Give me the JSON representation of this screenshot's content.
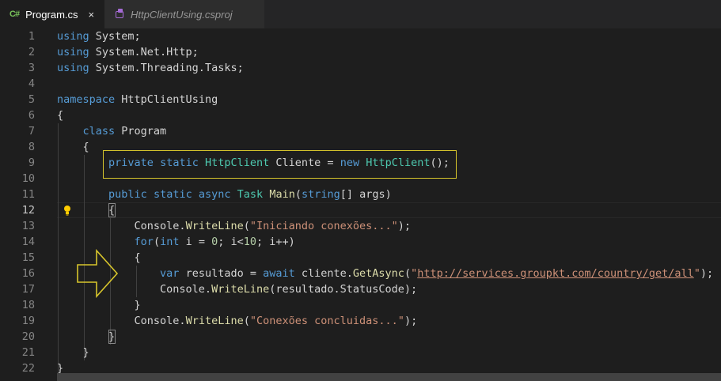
{
  "tabs": [
    {
      "icon": "C#",
      "label": "Program.cs",
      "close": "×"
    },
    {
      "label": "HttpClientUsing.csproj"
    }
  ],
  "lines": [
    {
      "n": "1",
      "t": [
        [
          "kw",
          "using"
        ],
        [
          "punc",
          " System;"
        ]
      ]
    },
    {
      "n": "2",
      "t": [
        [
          "kw",
          "using"
        ],
        [
          "punc",
          " System.Net.Http;"
        ]
      ]
    },
    {
      "n": "3",
      "t": [
        [
          "kw",
          "using"
        ],
        [
          "punc",
          " System.Threading.Tasks;"
        ]
      ]
    },
    {
      "n": "4",
      "t": []
    },
    {
      "n": "5",
      "t": [
        [
          "kw",
          "namespace"
        ],
        [
          "punc",
          " HttpClientUsing"
        ]
      ]
    },
    {
      "n": "6",
      "t": [
        [
          "punc",
          "{"
        ]
      ]
    },
    {
      "n": "7",
      "t": [
        [
          "punc",
          "    "
        ],
        [
          "kw",
          "class"
        ],
        [
          "punc",
          " Program"
        ]
      ]
    },
    {
      "n": "8",
      "t": [
        [
          "punc",
          "    {"
        ]
      ]
    },
    {
      "n": "9",
      "t": [
        [
          "punc",
          "        "
        ],
        [
          "kw",
          "private"
        ],
        [
          "punc",
          " "
        ],
        [
          "kw",
          "static"
        ],
        [
          "punc",
          " "
        ],
        [
          "ty",
          "HttpClient"
        ],
        [
          "punc",
          " Cliente = "
        ],
        [
          "kw",
          "new"
        ],
        [
          "punc",
          " "
        ],
        [
          "ty",
          "HttpClient"
        ],
        [
          "punc",
          "();"
        ]
      ]
    },
    {
      "n": "10",
      "t": []
    },
    {
      "n": "11",
      "t": [
        [
          "punc",
          "        "
        ],
        [
          "kw",
          "public"
        ],
        [
          "punc",
          " "
        ],
        [
          "kw",
          "static"
        ],
        [
          "punc",
          " "
        ],
        [
          "kw",
          "async"
        ],
        [
          "punc",
          " "
        ],
        [
          "ty",
          "Task"
        ],
        [
          "punc",
          " "
        ],
        [
          "fn",
          "Main"
        ],
        [
          "punc",
          "("
        ],
        [
          "kw",
          "string"
        ],
        [
          "punc",
          "[] args)"
        ]
      ]
    },
    {
      "n": "12",
      "t": [
        [
          "punc",
          "        {"
        ]
      ]
    },
    {
      "n": "13",
      "t": [
        [
          "punc",
          "            Console."
        ],
        [
          "fn",
          "WriteLine"
        ],
        [
          "punc",
          "("
        ],
        [
          "str",
          "\"Iniciando conexões...\""
        ],
        [
          "punc",
          ");"
        ]
      ]
    },
    {
      "n": "14",
      "t": [
        [
          "punc",
          "            "
        ],
        [
          "kw",
          "for"
        ],
        [
          "punc",
          "("
        ],
        [
          "kw",
          "int"
        ],
        [
          "punc",
          " i = "
        ],
        [
          "num",
          "0"
        ],
        [
          "punc",
          "; i<"
        ],
        [
          "num",
          "10"
        ],
        [
          "punc",
          "; i++)"
        ]
      ]
    },
    {
      "n": "15",
      "t": [
        [
          "punc",
          "            {"
        ]
      ]
    },
    {
      "n": "16",
      "t": [
        [
          "punc",
          "                "
        ],
        [
          "kw",
          "var"
        ],
        [
          "punc",
          " resultado = "
        ],
        [
          "kw",
          "await"
        ],
        [
          "punc",
          " cliente."
        ],
        [
          "fn",
          "GetAsync"
        ],
        [
          "punc",
          "("
        ],
        [
          "str",
          "\""
        ],
        [
          "url",
          "http://services.groupkt.com/country/get/all"
        ],
        [
          "str",
          "\""
        ],
        [
          "punc",
          ");"
        ]
      ]
    },
    {
      "n": "17",
      "t": [
        [
          "punc",
          "                Console."
        ],
        [
          "fn",
          "WriteLine"
        ],
        [
          "punc",
          "(resultado.StatusCode);"
        ]
      ]
    },
    {
      "n": "18",
      "t": [
        [
          "punc",
          "            }"
        ]
      ]
    },
    {
      "n": "19",
      "t": [
        [
          "punc",
          "            Console."
        ],
        [
          "fn",
          "WriteLine"
        ],
        [
          "punc",
          "("
        ],
        [
          "str",
          "\"Conexões concluidas...\""
        ],
        [
          "punc",
          ");"
        ]
      ]
    },
    {
      "n": "20",
      "t": [
        [
          "punc",
          "        }"
        ]
      ]
    },
    {
      "n": "21",
      "t": [
        [
          "punc",
          "    }"
        ]
      ]
    },
    {
      "n": "22",
      "t": [
        [
          "punc",
          "}"
        ]
      ]
    }
  ],
  "current_line": "12",
  "colors": {
    "highlight": "#d7c52c",
    "keyword": "#569cd6",
    "type": "#4ec9b0",
    "string": "#ce9178"
  }
}
